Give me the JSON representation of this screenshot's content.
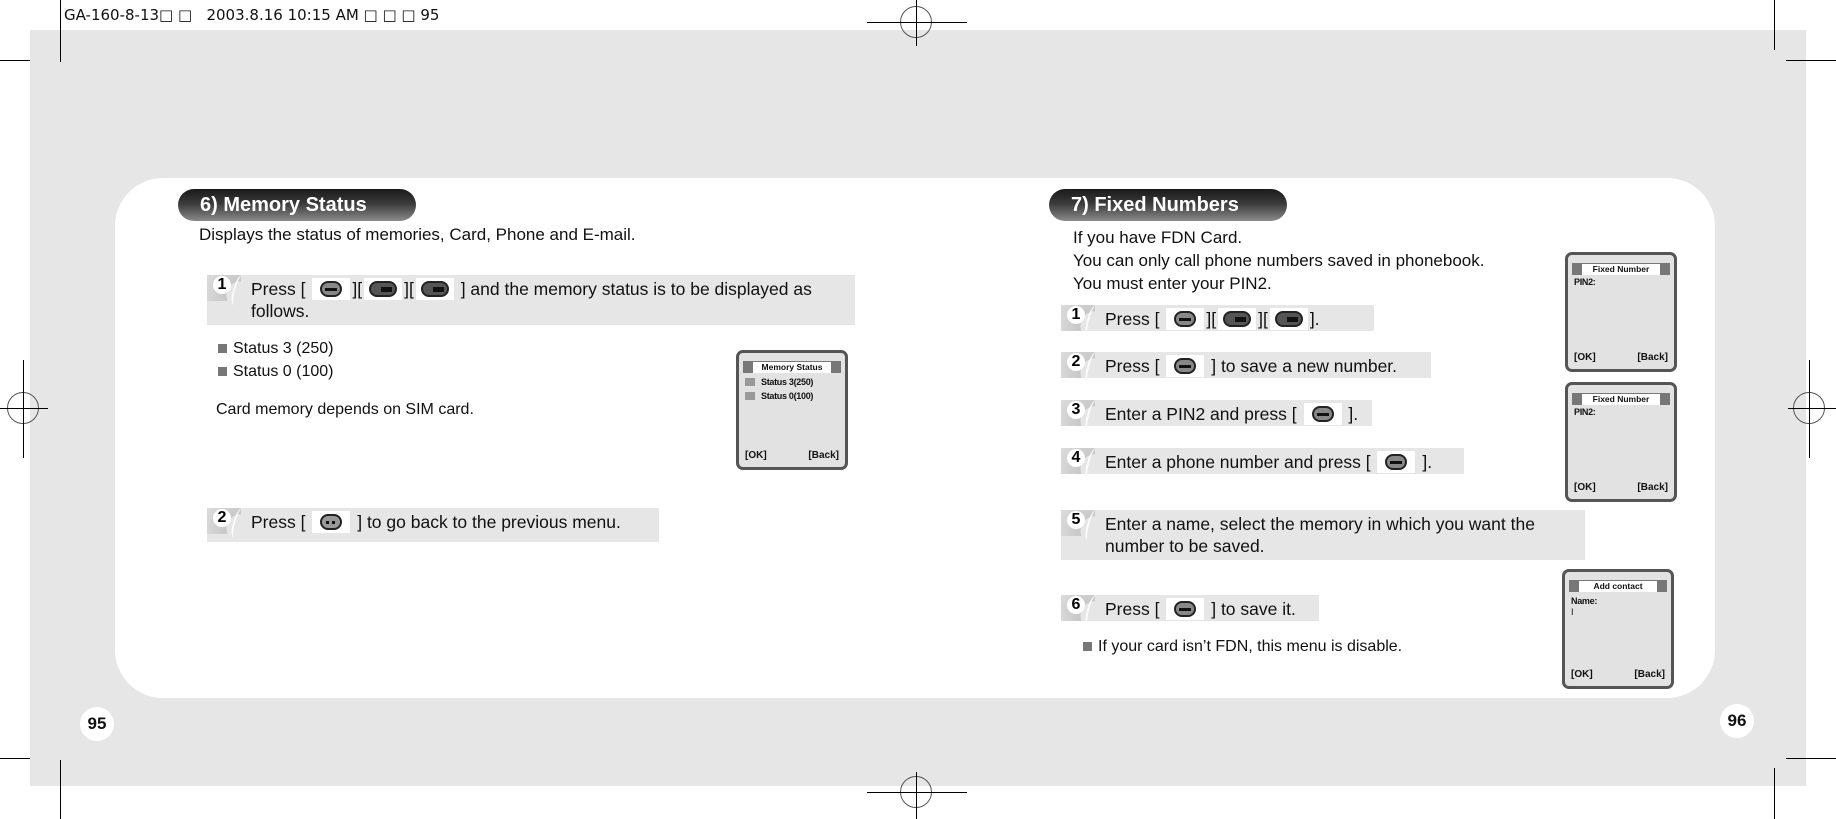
{
  "print_header": "GA-160-8-13□ □   2003.8.16 10:15 AM □ □ □ 95",
  "pages": {
    "left": "95",
    "right": "96"
  },
  "memory_status": {
    "title": "6) Memory Status",
    "intro": "Displays the status of memories, Card, Phone and E-mail.",
    "steps": [
      {
        "num": "1",
        "before": "Press [",
        "keys": [
          "ok-key",
          "4-key",
          "6-key"
        ],
        "after": "] and the memory status is to be displayed as follows."
      },
      {
        "num": "2",
        "before": "Press [",
        "keys": [
          "back-key"
        ],
        "after": "] to go back to the previous menu."
      }
    ],
    "bullets": [
      "Status 3 (250)",
      "Status 0 (100)"
    ],
    "note": "Card memory depends on SIM card.",
    "screen": {
      "title": "Memory Status",
      "lines": [
        "Status 3(250)",
        "Status 0(100)"
      ],
      "soft_left": "[OK]",
      "soft_right": "[Back]"
    }
  },
  "fixed_numbers": {
    "title": "7) Fixed Numbers",
    "intro": [
      "If you have FDN Card.",
      "You can only call phone numbers saved in phonebook.",
      "You must enter your PIN2."
    ],
    "steps": [
      {
        "num": "1",
        "before": "Press [",
        "after": "]."
      },
      {
        "num": "2",
        "before": "Press [",
        "after": "] to save a new number."
      },
      {
        "num": "3",
        "before": "Enter a PIN2 and press [",
        "after": "]."
      },
      {
        "num": "4",
        "before": "Enter a phone number and press [",
        "after": "]."
      },
      {
        "num": "5",
        "text": "Enter a name, select the memory in which you want the number to be saved."
      },
      {
        "num": "6",
        "before": "Press [",
        "after": "] to save it."
      }
    ],
    "bullet": "If your card isn’t FDN, this menu is disable.",
    "screens": [
      {
        "title": "Fixed Number",
        "line": "PIN2:",
        "soft_left": "[OK]",
        "soft_right": "[Back]"
      },
      {
        "title": "Fixed Number",
        "line": "PIN2:",
        "soft_left": "[OK]",
        "soft_right": "[Back]"
      },
      {
        "title": "Add contact",
        "line": "Name:",
        "cursor": "I",
        "soft_left": "[OK]",
        "soft_right": "[Back]"
      }
    ]
  },
  "key_separator": "][",
  "close_bracket": "]"
}
